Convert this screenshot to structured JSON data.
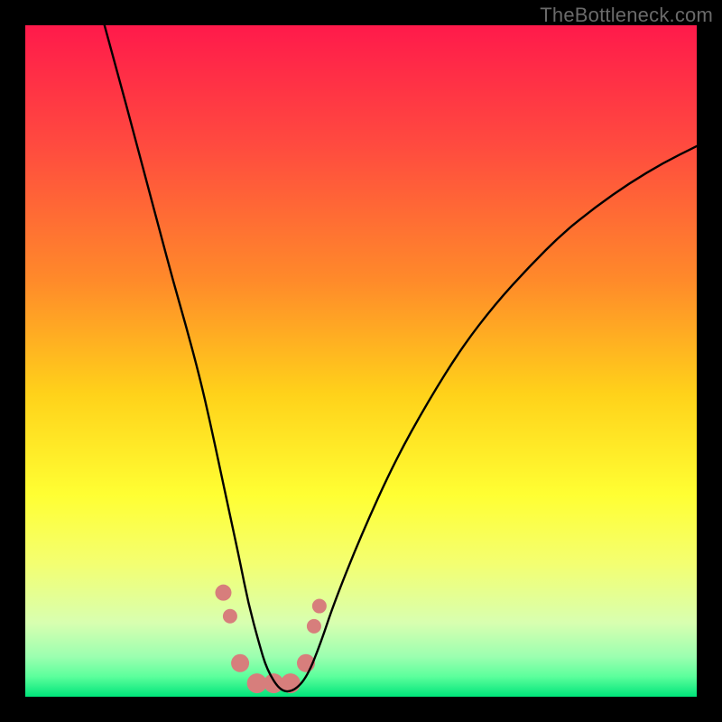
{
  "watermark": "TheBottleneck.com",
  "chart_data": {
    "type": "line",
    "title": "",
    "xlabel": "",
    "ylabel": "",
    "xlim": [
      0,
      100
    ],
    "ylim": [
      0,
      100
    ],
    "grid": false,
    "legend": false,
    "background_gradient": {
      "stops": [
        {
          "pct": 0,
          "color": "#ff1a4b"
        },
        {
          "pct": 18,
          "color": "#ff4b3f"
        },
        {
          "pct": 38,
          "color": "#ff8a2a"
        },
        {
          "pct": 55,
          "color": "#ffd21a"
        },
        {
          "pct": 70,
          "color": "#ffff33"
        },
        {
          "pct": 80,
          "color": "#f4ff70"
        },
        {
          "pct": 89,
          "color": "#d8ffb0"
        },
        {
          "pct": 94,
          "color": "#9cffb0"
        },
        {
          "pct": 97,
          "color": "#5cff9c"
        },
        {
          "pct": 100,
          "color": "#00e47a"
        }
      ]
    },
    "series": [
      {
        "name": "bottleneck-curve",
        "color": "#000000",
        "width": 2.4,
        "x": [
          11.8,
          14,
          16,
          18,
          20,
          22,
          24,
          26,
          27.5,
          29,
          30.5,
          32,
          33.2,
          34.8,
          36,
          38,
          40,
          42,
          44,
          46,
          50,
          55,
          60,
          65,
          70,
          75,
          80,
          85,
          90,
          95,
          100
        ],
        "y": [
          100,
          92,
          84.5,
          77,
          69.5,
          62,
          55,
          47.5,
          41,
          34,
          27,
          20,
          14,
          8,
          4,
          0.8,
          0.8,
          3,
          8,
          14,
          24,
          35,
          44,
          52,
          58.5,
          64,
          69,
          73,
          76.5,
          79.5,
          82
        ]
      }
    ],
    "marker_band": {
      "name": "optimal-zone-markers",
      "color": "#d77e7c",
      "points": [
        {
          "x": 29.5,
          "y": 15.5,
          "r": 9
        },
        {
          "x": 30.5,
          "y": 12.0,
          "r": 8
        },
        {
          "x": 32.0,
          "y": 5.0,
          "r": 10
        },
        {
          "x": 34.5,
          "y": 2.0,
          "r": 11
        },
        {
          "x": 37.0,
          "y": 2.0,
          "r": 11
        },
        {
          "x": 39.5,
          "y": 2.0,
          "r": 11
        },
        {
          "x": 41.8,
          "y": 5.0,
          "r": 10
        },
        {
          "x": 43.0,
          "y": 10.5,
          "r": 8
        },
        {
          "x": 43.8,
          "y": 13.5,
          "r": 8
        }
      ]
    }
  }
}
